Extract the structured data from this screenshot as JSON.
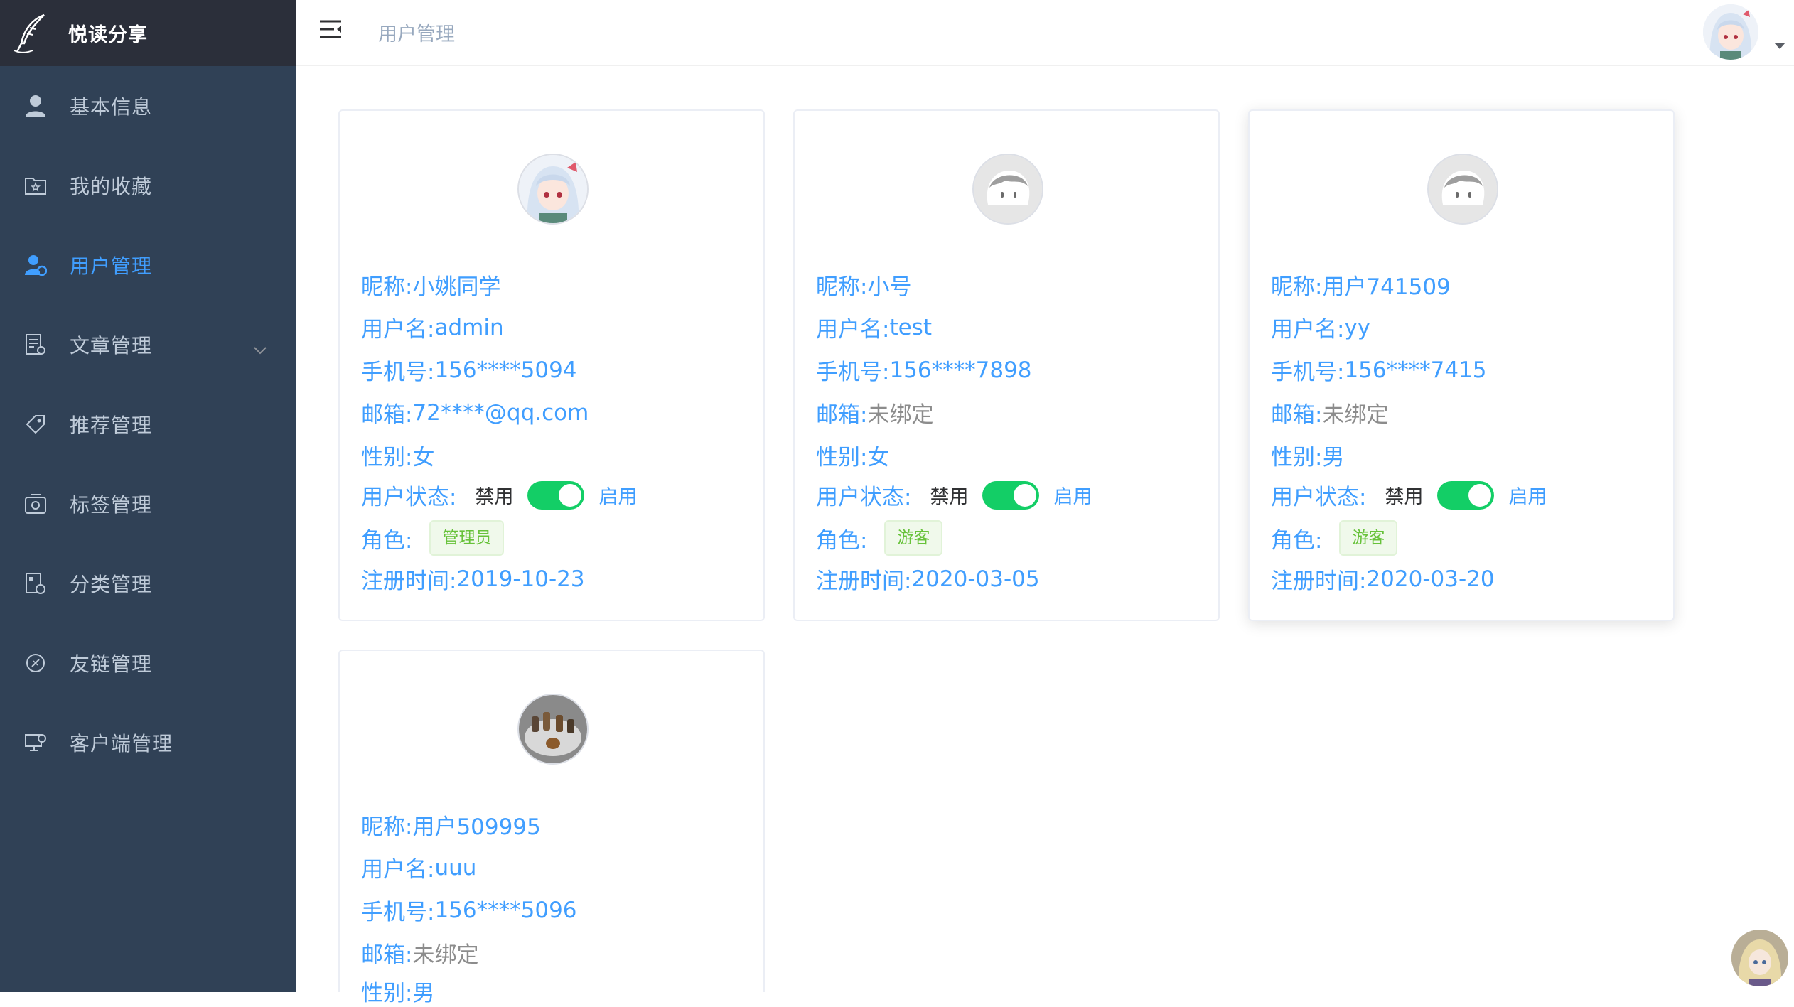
{
  "app": {
    "title": "悦读分享"
  },
  "sidebar": {
    "items": [
      {
        "label": "基本信息",
        "icon": "user-icon"
      },
      {
        "label": "我的收藏",
        "icon": "folder-star-icon"
      },
      {
        "label": "用户管理",
        "icon": "user-manage-icon",
        "active": true
      },
      {
        "label": "文章管理",
        "icon": "document-icon",
        "expandable": true
      },
      {
        "label": "推荐管理",
        "icon": "tag-icon"
      },
      {
        "label": "标签管理",
        "icon": "label-box-icon"
      },
      {
        "label": "分类管理",
        "icon": "category-icon"
      },
      {
        "label": "友链管理",
        "icon": "link-icon"
      },
      {
        "label": "客户端管理",
        "icon": "client-icon"
      }
    ]
  },
  "header": {
    "breadcrumb": "用户管理"
  },
  "labels": {
    "nickname": "昵称:",
    "username": "用户名:",
    "phone": "手机号:",
    "email": "邮箱:",
    "gender": "性别:",
    "status": "用户状态:",
    "disable": "禁用",
    "enable": "启用",
    "role": "角色:",
    "register_time": "注册时间:"
  },
  "users": [
    {
      "nickname": "小姚同学",
      "username": "admin",
      "phone": "156****5094",
      "email": "72****@qq.com",
      "email_bound": true,
      "gender": "女",
      "status_enabled": true,
      "role": "管理员",
      "register_time": "2019-10-23",
      "avatar": "anime-avatar"
    },
    {
      "nickname": "小号",
      "username": "test",
      "phone": "156****7898",
      "email": "未绑定",
      "email_bound": false,
      "gender": "女",
      "status_enabled": true,
      "role": "游客",
      "register_time": "2020-03-05",
      "avatar": "default-avatar"
    },
    {
      "nickname": "用户741509",
      "username": "yy",
      "phone": "156****7415",
      "email": "未绑定",
      "email_bound": false,
      "gender": "男",
      "status_enabled": true,
      "role": "游客",
      "register_time": "2020-03-20",
      "avatar": "default-avatar"
    },
    {
      "nickname": "用户509995",
      "username": "uuu",
      "phone": "156****5096",
      "email": "未绑定",
      "email_bound": false,
      "gender": "男",
      "avatar": "photo-avatar"
    }
  ],
  "colors": {
    "sidebar_bg": "#304156",
    "logo_bg": "#2b2f3a",
    "accent": "#409eff",
    "switch_on": "#13ce66",
    "tag_green": "#67c23a"
  }
}
